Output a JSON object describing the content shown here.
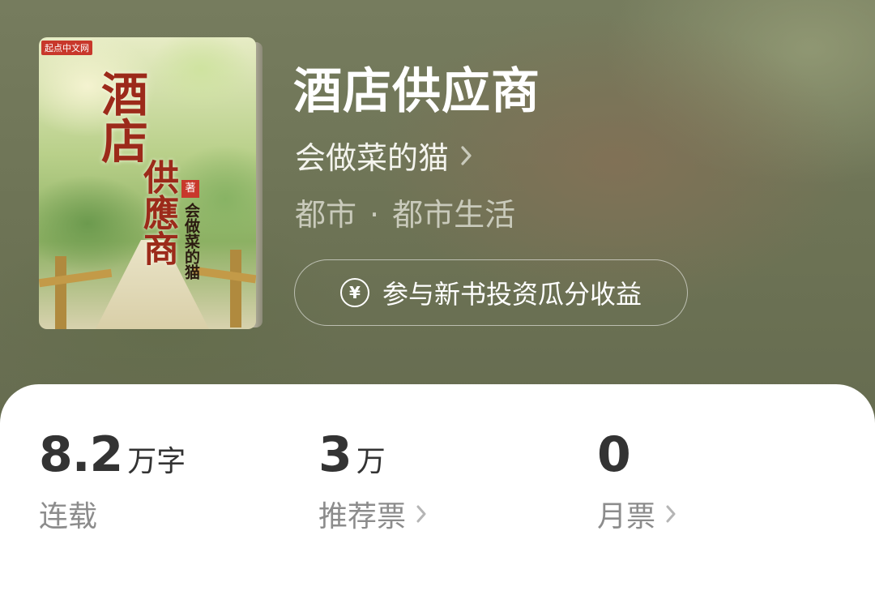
{
  "book": {
    "title": "酒店供应商",
    "author": "会做菜的猫",
    "genre_main": "都市",
    "genre_separator": "·",
    "genre_sub": "都市生活",
    "invest_button": "参与新书投资瓜分收益"
  },
  "cover": {
    "tag": "起点中文网",
    "title_chars": "酒店",
    "subtitle_chars": "供應商",
    "zhu": "著",
    "author_chars": "会做菜的猫"
  },
  "stats": {
    "words": {
      "value": "8.2",
      "unit": "万字",
      "label": "连载"
    },
    "recommend": {
      "value": "3",
      "unit": "万",
      "label": "推荐票"
    },
    "monthly": {
      "value": "0",
      "unit": "",
      "label": "月票"
    }
  },
  "icons": {
    "chevron": "chevron-right-icon",
    "invest": "yen-coin-icon"
  }
}
